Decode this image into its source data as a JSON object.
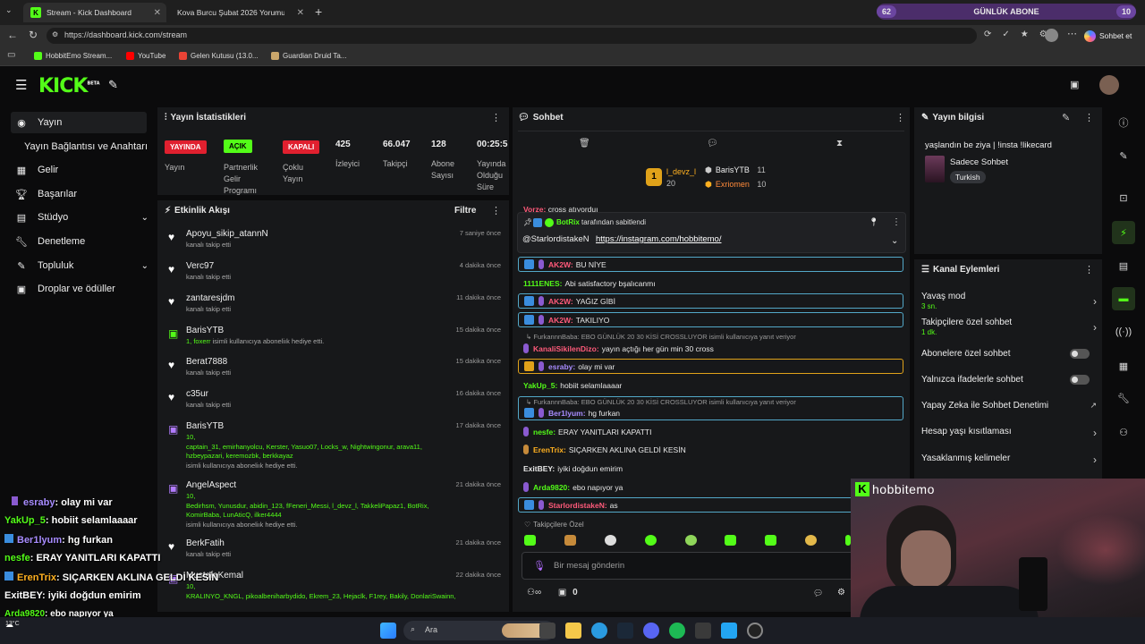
{
  "browser": {
    "tabs": [
      {
        "title": "Stream - Kick Dashboard",
        "active": true
      },
      {
        "title": "Kova Burcu Şubat 2026 Yorumu - G",
        "active": false
      }
    ],
    "url": "https://dashboard.kick.com/stream",
    "copilot_label": "Sohbet et",
    "bookmarks": [
      "HobbitEmo Stream...",
      "YouTube",
      "Gelen Kutusu (13.0...",
      "Guardian Druid Ta..."
    ],
    "sub_goal": {
      "left": "62",
      "label": "GÜNLÜK ABONE",
      "right": "10"
    }
  },
  "app": {
    "logo": "KICK",
    "logo_badge": "BETA"
  },
  "sidebar": {
    "items": [
      {
        "label": "Yayın",
        "icon": "broadcast-icon",
        "selected": true
      },
      {
        "label": "Yayın Bağlantısı ve Anahtarı",
        "icon": "",
        "selected": false
      },
      {
        "label": "Gelir",
        "icon": "grid-icon",
        "selected": false
      },
      {
        "label": "Başarılar",
        "icon": "trophy-icon",
        "selected": false
      },
      {
        "label": "Stüdyo",
        "icon": "studio-icon",
        "selected": false
      },
      {
        "label": "Denetleme",
        "icon": "wrench-icon",
        "selected": false
      },
      {
        "label": "Topluluk",
        "icon": "community-icon",
        "selected": false
      },
      {
        "label": "Droplar ve ödüller",
        "icon": "gift-icon",
        "selected": false
      }
    ]
  },
  "stats": {
    "title": "Yayın İstatistikleri",
    "status_badge": "YAYINDA",
    "status_label": "Yayın",
    "partner_badge": "AÇIK",
    "partner_label": "Partnerlik Gelir Programı",
    "multi_badge": "KAPALI",
    "multi_label": "Çoklu Yayın",
    "viewers": "425",
    "viewers_label": "İzleyici",
    "followers": "66.047",
    "followers_label": "Takipçi",
    "subs": "128",
    "subs_label": "Abone Sayısı",
    "uptime": "00:25:5",
    "uptime_label": "Yayında Olduğu Süre"
  },
  "feed": {
    "title": "Etkinlik Akışı",
    "filter": "Filtre",
    "events": [
      {
        "name": "Apoyu_sikip_atannN",
        "sub": "kanalı takip etti",
        "time": "7 saniye önce",
        "icon": "heart-icon"
      },
      {
        "name": "Verc97",
        "sub": "kanalı takip etti",
        "time": "4 dakika önce",
        "icon": "heart-icon"
      },
      {
        "name": "zantaresjdm",
        "sub": "kanalı takip etti",
        "time": "11 dakika önce",
        "icon": "heart-icon"
      },
      {
        "name": "BarisYTB",
        "sub_hl": "1, foxerr",
        "sub": "isimli kullanıcıya aboneliık hediye etti.",
        "time": "15 dakika önce",
        "icon": "gift-icon"
      },
      {
        "name": "Berat7888",
        "sub": "kanalı takip etti",
        "time": "15 dakika önce",
        "icon": "heart-icon"
      },
      {
        "name": "c35ur",
        "sub": "kanalı takip etti",
        "time": "16 dakika önce",
        "icon": "heart-icon"
      },
      {
        "name": "BarisYTB",
        "list": [
          "10,",
          "captain_31, emirhanyolcu, Kerster, Yasuo07, Locks_w, Nightwingonur, arava11,",
          "hzbeypazari, keremozbk, berkkayaz"
        ],
        "sub": "isimli kullanıcıya aboneliık hediye etti.",
        "time": "17 dakika önce",
        "icon": "gift-icon"
      },
      {
        "name": "AngelAspect",
        "list": [
          "10,",
          "Bedirhsm, Yunusdur, abidin_123, fFeneri_Messi, l_devz_l, TakkeliPapaz1, BotRix,",
          "KomirBaba, LunAticQ, ilker4444"
        ],
        "sub": "isimli kullanıcıya aboneliık hediye etti.",
        "time": "21 dakika önce",
        "icon": "gift-icon"
      },
      {
        "name": "BerkFatih",
        "sub": "kanalı takip etti",
        "time": "21 dakika önce",
        "icon": "heart-icon"
      },
      {
        "name": "MustafaKemal",
        "list": [
          "10,",
          "KRALINYO_KNGL, pikoalbeniharbydido, Ekrem_23, Hejaclk, F1rey, Bakily, DonlariSwainn,"
        ],
        "sub": "",
        "time": "22 dakika önce",
        "icon": "gift-icon"
      }
    ]
  },
  "chat": {
    "title": "Sohbet",
    "top_gifters": [
      {
        "rank": "1",
        "name": "l_devz_l",
        "count": "20"
      },
      {
        "name": "BarisYTB",
        "count": "11"
      },
      {
        "name": "Exriomen",
        "count": "10"
      }
    ],
    "partial_line": {
      "user": "Vorze:",
      "text": "cross atıyorduı"
    },
    "pinned": {
      "by": "BotRix",
      "by_suffix": "tarafından sabitlendi",
      "mention": "@StarlordistakeN",
      "link": "https://instagram.com/hobbitemo/"
    },
    "messages": [
      {
        "user": "AK2W:",
        "text": "BU NİYE",
        "color": "#ff5a7a",
        "boxed": true
      },
      {
        "user": "1111ENES:",
        "text": "Abi satisfactory bşalıcanmı",
        "color": "#53fc18",
        "boxed": false
      },
      {
        "user": "AK2W:",
        "text": "YAĞIZ GİBİ",
        "color": "#ff5a7a",
        "boxed": true
      },
      {
        "user": "AK2W:",
        "text": "TAKILIYO",
        "color": "#ff5a7a",
        "boxed": true
      },
      {
        "user": "KanaliSikilenDizo:",
        "text": "yayın açtığı her gün min 30 cross",
        "color": "#ff5a7a",
        "boxed": false,
        "reply": "FurkannnBaba: EBO GÜNLÜK 20 30 KİSİ CROSSLUYOR isimli kullanıcıya yanıt veriyor"
      },
      {
        "user": "esraby:",
        "text": "olay mi var",
        "color": "#a88cff",
        "boxed": true,
        "gold": true
      },
      {
        "user": "YakUp_5:",
        "text": "hobiit selamlaaaar",
        "color": "#53fc18",
        "boxed": false
      },
      {
        "user": "Ber1lyum:",
        "text": "hg furkan",
        "color": "#a88cff",
        "boxed": true,
        "reply": "FurkannnBaba: EBO GÜNLÜK 20 30 KİSİ CROSSLUYOR isimli kullanıcıya yanıt veriyor"
      },
      {
        "user": "nesfe:",
        "text": "ERAY YANITLARI KAPATTI",
        "color": "#53fc18",
        "boxed": false
      },
      {
        "user": "ErenTrix:",
        "text": "SIÇARKEN AKLINA GELDİ KESİN",
        "color": "#ffb020",
        "boxed": false
      },
      {
        "user": "ExitBEY:",
        "text": "iyiki doğdun emirim",
        "color": "#e8e8e8",
        "boxed": false
      },
      {
        "user": "Arda9820:",
        "text": "ebo napıyor ya",
        "color": "#53fc18",
        "boxed": false
      },
      {
        "user": "StarlordistakeN:",
        "text": "as",
        "color": "#ff5a7a",
        "boxed": true
      }
    ],
    "followers_only": "Takipçilere Özel",
    "input_placeholder": "Bir mesaj gönderin",
    "points": "0"
  },
  "info": {
    "title": "Yayın bilgisi",
    "stream_title": "yaşlandın be ziya | !insta !likecard",
    "category": "Sadece Sohbet",
    "language": "Turkish"
  },
  "channel_actions": {
    "title": "Kanal Eylemleri",
    "rows": [
      {
        "label": "Yavaş mod",
        "sub": "3 sn.",
        "type": "arrow"
      },
      {
        "label": "Takipçilere özel sohbet",
        "sub": "1 dk.",
        "type": "arrow"
      },
      {
        "label": "Abonelere özel sohbet",
        "sub": "",
        "type": "toggle"
      },
      {
        "label": "Yalnızca ifadelerle sohbet",
        "sub": "",
        "type": "toggle"
      },
      {
        "label": "Yapay Zeka ile Sohbet Denetimi",
        "sub": "",
        "type": "external"
      },
      {
        "label": "Hesap yaşı kısıtlaması",
        "sub": "",
        "type": "arrow"
      },
      {
        "label": "Yasaklanmış kelimeler",
        "sub": "",
        "type": "arrow"
      }
    ]
  },
  "webcam": {
    "label": "hobbitemo"
  },
  "overlay_chat": [
    {
      "user": "esraby",
      "text": ": olay mi var",
      "color": "#a88cff"
    },
    {
      "user": "YakUp_5",
      "text": ": hobiit selamlaaaar",
      "color": "#53fc18"
    },
    {
      "user": "Ber1lyum",
      "text": ": hg furkan",
      "color": "#a88cff"
    },
    {
      "user": "nesfe",
      "text": ": ERAY YANITLARI KAPATTI",
      "color": "#53fc18"
    },
    {
      "user": "ErenTrix",
      "text": ": SIÇARKEN AKLINA GELDİ KESİN",
      "color": "#ffb020"
    },
    {
      "user": "ExitBEY",
      "text": ": iyiki doğdun emirim",
      "color": "#ffffff"
    },
    {
      "user": "Arda9820",
      "text": ": ebo napıyor ya",
      "color": "#53fc18"
    },
    {
      "user": "StarlordistakeN",
      "text": ": as",
      "color": "#ff5a7a"
    }
  ],
  "taskbar": {
    "weather": "13°C",
    "search": "Ara"
  }
}
